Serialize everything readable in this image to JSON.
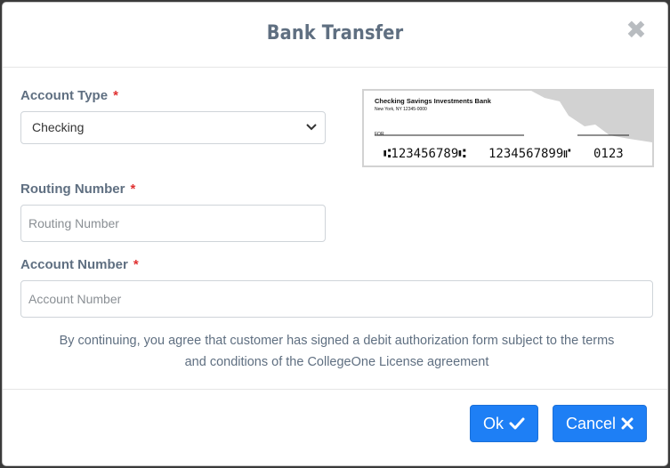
{
  "modal": {
    "title": "Bank Transfer",
    "close_symbol": "✖"
  },
  "form": {
    "account_type": {
      "label": "Account Type",
      "required": "*",
      "selected": "Checking"
    },
    "routing_number": {
      "label": "Routing Number",
      "required": "*",
      "placeholder": "Routing Number",
      "value": ""
    },
    "account_number": {
      "label": "Account Number",
      "required": "*",
      "placeholder": "Account Number",
      "value": ""
    }
  },
  "check_image": {
    "bank_name": "Checking Savings Investments Bank",
    "address": "New York, NY 12345-0000",
    "for_label": "FOR",
    "routing_digits": "⑆123456789⑆",
    "account_digits": "1234567899⑈",
    "check_number": "0123"
  },
  "notice": {
    "line1": "By continuing, you agree that customer has signed a debit authorization form subject to the terms",
    "line2": "and conditions of the CollegeOne License agreement"
  },
  "buttons": {
    "ok_label": "Ok",
    "cancel_label": "Cancel"
  },
  "colors": {
    "primary": "#1e7ff5",
    "label_text": "#5f6f81",
    "required": "#e03131"
  },
  "icons": {
    "close": "close-icon",
    "select_caret": "chevron-down-icon",
    "ok": "check-icon",
    "cancel": "x-icon"
  }
}
